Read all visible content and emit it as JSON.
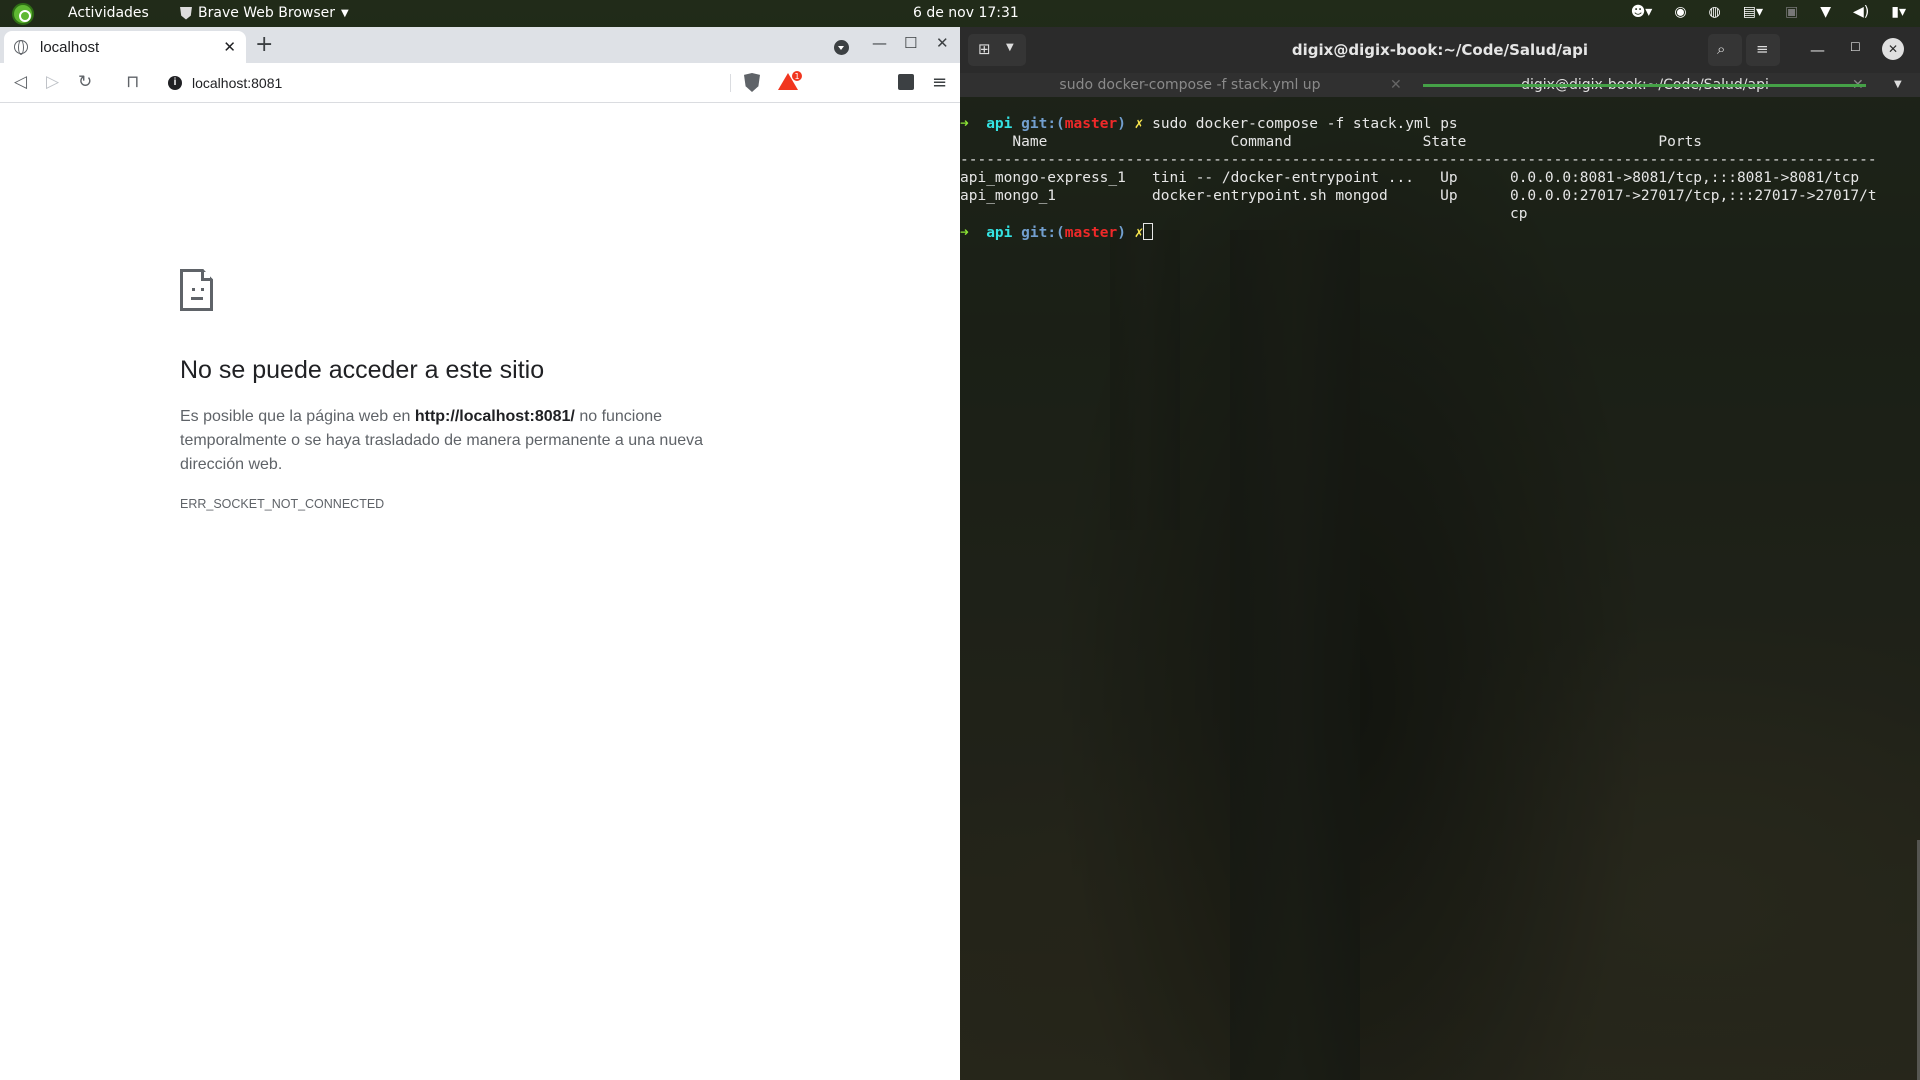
{
  "topbar": {
    "activities": "Actividades",
    "app_name": "Brave Web Browser",
    "clock": "6 de nov  17:31"
  },
  "browser": {
    "tab_title": "localhost",
    "url": "localhost:8081",
    "rewards_badge": "1",
    "error": {
      "title": "No se puede acceder a este sitio",
      "body_prefix": "Es posible que la página web en ",
      "body_url": "http://localhost:8081/",
      "body_suffix": " no funcione temporalmente o se haya trasladado de manera permanente a una nueva dirección web.",
      "code": "ERR_SOCKET_NOT_CONNECTED"
    }
  },
  "terminal": {
    "title": "digix@digix-book:~/Code/Salud/api",
    "tabs": [
      {
        "label": "sudo docker-compose -f stack.yml up",
        "active": false
      },
      {
        "label": "digix@digix-book:~/Code/Salud/api",
        "active": true
      }
    ],
    "prompt": {
      "arrow": "➜",
      "dir": "api",
      "git_label": "git:(",
      "branch": "master",
      "git_close": ")",
      "dirty": "✗"
    },
    "command": "sudo docker-compose -f stack.yml ps",
    "ps_header": "      Name                     Command               State                      Ports                   ",
    "ps_divider": "---------------------------------------------------------------------------------------------------------",
    "ps_rows": [
      "api_mongo-express_1   tini -- /docker-entrypoint ...   Up      0.0.0.0:8081->8081/tcp,:::8081->8081/tcp",
      "api_mongo_1           docker-entrypoint.sh mongod      Up      0.0.0.0:27017->27017/tcp,:::27017->27017/t",
      "                                                               cp"
    ]
  }
}
